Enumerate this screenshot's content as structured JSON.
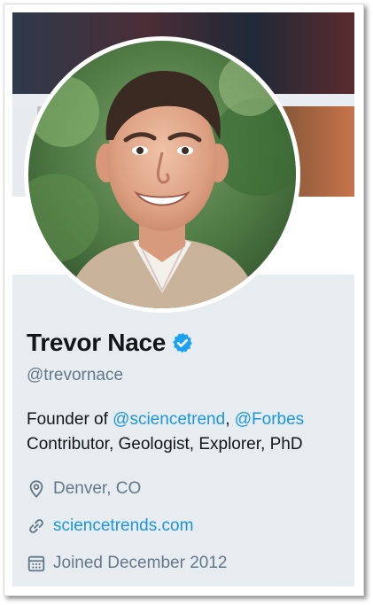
{
  "profile": {
    "display_name": "Trevor Nace",
    "verified": true,
    "handle": "@trevornace",
    "bio": {
      "prefix": "Founder of ",
      "mention_1": "@sciencetrend",
      "separator": ", ",
      "mention_2": "@Forbes",
      "suffix": "Contributor, Geologist, Explorer, PhD"
    },
    "location": "Denver, CO",
    "website": "sciencetrends.com",
    "joined": "Joined December 2012"
  },
  "icons": {
    "verified": "verified-badge-icon",
    "location": "location-pin-icon",
    "website": "link-icon",
    "joined": "calendar-icon"
  },
  "colors": {
    "link": "#1b95e0",
    "secondary_text": "#657786",
    "primary_text": "#14171a",
    "card_bg": "#e6ecf0",
    "verified": "#1da1f2"
  }
}
